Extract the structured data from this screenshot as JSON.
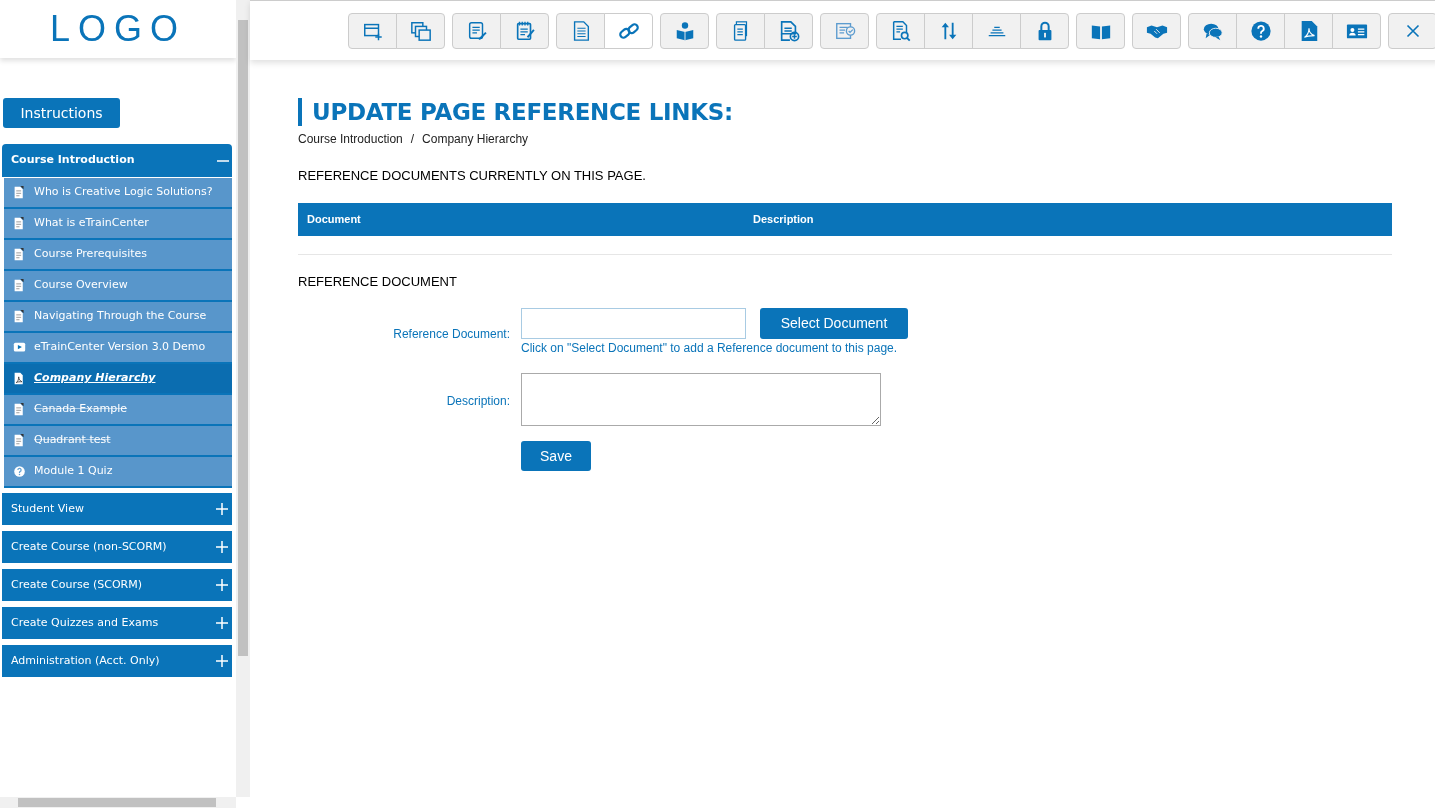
{
  "logo": {
    "text": "LOGO"
  },
  "toolbar": {
    "groups": [
      {
        "buttons": [
          {
            "kind": "window-add",
            "selected": false
          },
          {
            "kind": "copy",
            "selected": false
          }
        ]
      },
      {
        "buttons": [
          {
            "kind": "edit-doc",
            "selected": false
          },
          {
            "kind": "notepad",
            "selected": false
          }
        ]
      },
      {
        "buttons": [
          {
            "kind": "document",
            "selected": false
          },
          {
            "kind": "link",
            "selected": true
          }
        ]
      },
      {
        "buttons": [
          {
            "kind": "reader",
            "selected": false
          }
        ]
      },
      {
        "buttons": [
          {
            "kind": "docs",
            "selected": false
          },
          {
            "kind": "doc-add",
            "selected": false
          }
        ]
      },
      {
        "buttons": [
          {
            "kind": "doc-check",
            "selected": false
          }
        ]
      },
      {
        "buttons": [
          {
            "kind": "doc-search",
            "selected": false
          },
          {
            "kind": "sort",
            "selected": false
          },
          {
            "kind": "stack",
            "selected": false
          },
          {
            "kind": "lock",
            "selected": false
          }
        ]
      },
      {
        "buttons": [
          {
            "kind": "book",
            "selected": false
          }
        ]
      },
      {
        "buttons": [
          {
            "kind": "handshake",
            "selected": false
          }
        ]
      },
      {
        "buttons": [
          {
            "kind": "chat",
            "selected": false
          },
          {
            "kind": "help",
            "selected": false
          },
          {
            "kind": "pdf",
            "selected": false
          },
          {
            "kind": "id-card",
            "selected": false
          }
        ]
      },
      {
        "buttons": [
          {
            "kind": "close",
            "selected": false
          }
        ]
      }
    ]
  },
  "sidebar": {
    "instructions_button": "Instructions",
    "sections": [
      {
        "title": "Course Introduction",
        "expanded": true,
        "items": [
          {
            "label": "Who is Creative Logic Solutions?",
            "kind": "page",
            "selected": false,
            "struck_out": false
          },
          {
            "label": "What is eTrainCenter",
            "kind": "page",
            "selected": false,
            "struck_out": false
          },
          {
            "label": "Course Prerequisites",
            "kind": "page",
            "selected": false,
            "struck_out": false
          },
          {
            "label": "Course Overview",
            "kind": "page",
            "selected": false,
            "struck_out": false
          },
          {
            "label": "Navigating Through the Course",
            "kind": "page",
            "selected": false,
            "struck_out": false
          },
          {
            "label": "eTrainCenter Version 3.0 Demo",
            "kind": "video",
            "selected": false,
            "struck_out": false
          },
          {
            "label": "Company Hierarchy",
            "kind": "pdf",
            "selected": true,
            "struck_out": false
          },
          {
            "label": "Canada Example",
            "kind": "page",
            "selected": false,
            "struck_out": true
          },
          {
            "label": "Quadrant test",
            "kind": "page",
            "selected": false,
            "struck_out": true
          },
          {
            "label": "Module 1 Quiz",
            "kind": "quiz",
            "selected": false,
            "struck_out": false
          }
        ]
      },
      {
        "title": "Student View",
        "expanded": false
      },
      {
        "title": "Create Course (non-SCORM)",
        "expanded": false
      },
      {
        "title": "Create Course (SCORM)",
        "expanded": false
      },
      {
        "title": "Create Quizzes and Exams",
        "expanded": false
      },
      {
        "title": "Administration (Acct. Only)",
        "expanded": false
      }
    ]
  },
  "main": {
    "title": "UPDATE PAGE REFERENCE LINKS:",
    "breadcrumb": [
      "Course Introduction",
      "Company Hierarchy"
    ],
    "breadcrumb_separator": "/",
    "current_heading": "REFERENCE DOCUMENTS CURRENTLY ON THIS PAGE.",
    "table": {
      "columns": [
        "Document",
        "Description"
      ]
    },
    "form_heading": "REFERENCE DOCUMENT",
    "reference_label": "Reference Document:",
    "select_button": "Select Document",
    "help_text": "Click on \"Select Document\" to add a Reference document to this page.",
    "description_label": "Description:",
    "save_button": "Save"
  }
}
